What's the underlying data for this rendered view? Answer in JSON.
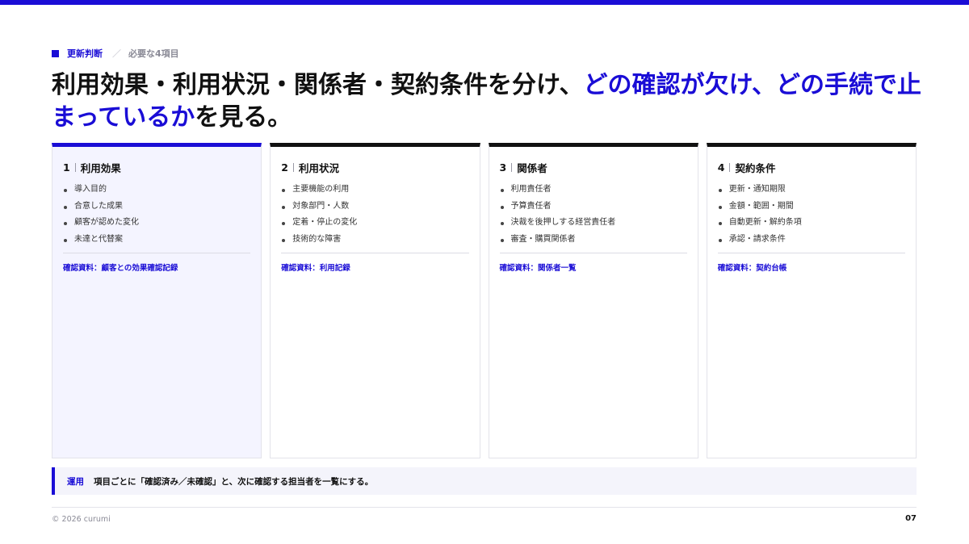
{
  "eyebrow": {
    "section": "更新判断",
    "separator": "／",
    "subtitle": "必要な4項目"
  },
  "headline": {
    "part1": "利用効果・利用状況・関係者・契約条件を分け、",
    "part2": "どの確認が欠け、どの手続で止まっているか",
    "part3": "を見る。"
  },
  "cards": [
    {
      "number": "1",
      "title": "利用効果",
      "items": [
        "導入目的",
        "合意した成果",
        "顧客が認めた変化",
        "未達と代替案"
      ],
      "ref": "確認資料：顧客との効果確認記録"
    },
    {
      "number": "2",
      "title": "利用状況",
      "items": [
        "主要機能の利用",
        "対象部門・人数",
        "定着・停止の変化",
        "技術的な障害"
      ],
      "ref": "確認資料：利用記録"
    },
    {
      "number": "3",
      "title": "関係者",
      "items": [
        "利用責任者",
        "予算責任者",
        "決裁を後押しする経営責任者",
        "審査・購買関係者"
      ],
      "ref": "確認資料：関係者一覧"
    },
    {
      "number": "4",
      "title": "契約条件",
      "items": [
        "更新・通知期限",
        "金額・範囲・期間",
        "自動更新・解約条項",
        "承認・請求条件"
      ],
      "ref": "確認資料：契約台帳"
    }
  ],
  "note": {
    "tag": "運用",
    "text": "項目ごとに「確認済み／未確認」と、次に確認する担当者を一覧にする。"
  },
  "footer": {
    "copyright": "© 2026 curumi",
    "page": "07"
  },
  "colors": {
    "accent": "#1a0dd6",
    "text": "#111111",
    "active_card_bg": "#f4f4ff"
  }
}
